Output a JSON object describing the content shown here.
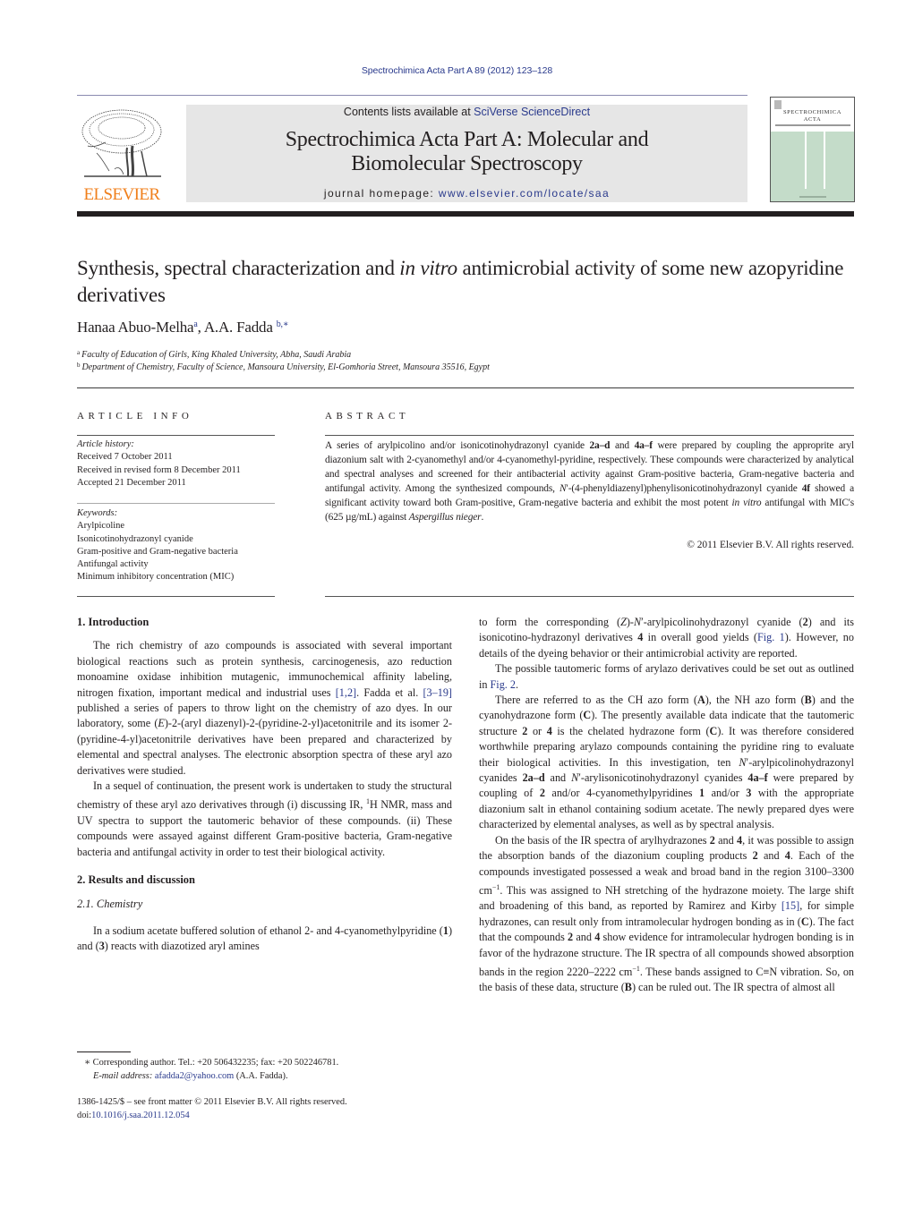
{
  "header": {
    "running_head": "Spectrochimica Acta Part A 89 (2012) 123–128",
    "contents_prefix": "Contents lists available at ",
    "contents_link": "SciVerse ScienceDirect",
    "journal_title_line1": "Spectrochimica Acta Part A: Molecular and",
    "journal_title_line2": "Biomolecular Spectroscopy",
    "homepage_prefix": "journal homepage: ",
    "homepage_link": "www.elsevier.com/locate/saa",
    "publisher_logo_text": "ELSEVIER",
    "cover_title_line1": "SPECTROCHIMICA",
    "cover_title_line2": "ACTA",
    "colors": {
      "link": "#2a3a8c",
      "elsevier_orange": "#f07f1b",
      "box_gray": "#e6e6e6",
      "cover_green": "#c4dcc9"
    }
  },
  "article": {
    "title_part1": "Synthesis, spectral characterization and ",
    "title_italic": "in vitro",
    "title_part2": " antimicrobial activity of some new azopyridine derivatives",
    "authors": [
      {
        "name": "Hanaa Abuo-Melha",
        "sup": "a"
      },
      {
        "name": "A.A. Fadda",
        "sup": "b,∗"
      }
    ],
    "author_separator": ", ",
    "affiliations": [
      {
        "mark": "a",
        "text": "Faculty of Education of Girls, King Khaled University, Abha, Saudi Arabia"
      },
      {
        "mark": "b",
        "text": "Department of Chemistry, Faculty of Science, Mansoura University, El-Gomhoria Street, Mansoura 35516, Egypt"
      }
    ]
  },
  "article_info": {
    "label": "ARTICLE INFO",
    "history_head": "Article history:",
    "history": [
      "Received 7 October 2011",
      "Received in revised form 8 December 2011",
      "Accepted 21 December 2011"
    ],
    "keywords_head": "Keywords:",
    "keywords": [
      "Arylpicoline",
      "Isonicotinohydrazonyl cyanide",
      "Gram-positive and Gram-negative bacteria",
      "Antifungal activity",
      "Minimum inhibitory concentration (MIC)"
    ]
  },
  "abstract": {
    "label": "ABSTRACT",
    "t1": "A series of arylpicolino and/or isonicotinohydrazonyl cyanide ",
    "b1": "2a–d",
    "t2": " and ",
    "b2": "4a–f",
    "t3": " were prepared by coupling the approprite aryl diazonium salt with 2-cyanomethyl and/or 4-cyanomethyl-pyridine, respectively. These compounds were characterized by analytical and spectral analyses and screened for their antibacterial activity against Gram-positive bacteria, Gram-negative bacteria and antifungal activity. Among the synthesized compounds, ",
    "i1": "N",
    "t4": "′-(4-phenyldiazenyl)phenylisonicotinohydrazonyl cyanide ",
    "b3": "4f",
    "t5": " showed a significant activity toward both Gram-positive, Gram-negative bacteria and exhibit the most potent ",
    "i2": "in vitro",
    "t6": " antifungal with MIC's (625 µg/mL) against ",
    "i3": "Aspergillus nieger",
    "t7": ".",
    "copyright": "© 2011 Elsevier B.V. All rights reserved."
  },
  "body": {
    "sec1_heading": "1.  Introduction",
    "intro_p1": {
      "a": "The rich chemistry of azo compounds is associated with several important biological reactions such as protein synthesis, carcinogenesis, azo reduction monoamine oxidase inhibition mutagenic, immunochemical affinity labeling, nitrogen fixation, important medical and industrial uses ",
      "ref1": "[1,2]",
      "b": ". Fadda et al. ",
      "ref2": "[3–19]",
      "c": " published a series of papers to throw light on the chemistry of azo dyes. In our laboratory, some (",
      "e": "E",
      "d": ")-2-(aryl diazenyl)-2-(pyridine-2-yl)acetonitrile and its isomer 2-(pyridine-4-yl)acetonitrile derivatives have been prepared and characterized by elemental and spectral analyses. The electronic absorption spectra of these aryl azo derivatives were studied."
    },
    "intro_p2": {
      "a": "In a sequel of continuation, the present work is undertaken to study the structural chemistry of these aryl azo derivatives through (i) discussing IR, ",
      "sup": "1",
      "b": "H NMR, mass and UV spectra to support the tautomeric behavior of these compounds. (ii) These compounds were assayed against different Gram-positive bacteria, Gram-negative bacteria and antifungal activity in order to test their biological activity."
    },
    "sec2_heading": "2.  Results and discussion",
    "sec21_heading": "2.1.  Chemistry",
    "chem_p1": {
      "a": "In a sodium acetate buffered solution of ethanol 2- and 4-cyanomethylpyridine (",
      "b1": "1",
      "b": ") and (",
      "b2": "3",
      "c": ") reacts with diazotized aryl amines to form the corresponding (",
      "z": "Z",
      "d": ")-",
      "n": "N",
      "e": "′-arylpicolinohydrazonyl cyanide (",
      "b3": "2",
      "f": ") and its isonicotino-hydrazonyl derivatives ",
      "b4": "4",
      "g": " in overall good yields (",
      "ref": "Fig. 1",
      "h": "). However, no details of the dyeing behavior or their antimicrobial activity are reported."
    },
    "right_p2": {
      "a": "The possible tautomeric forms of arylazo derivatives could be set out as outlined in ",
      "ref": "Fig. 2",
      "b": "."
    },
    "right_p3": {
      "a": "There are referred to as the CH azo form (",
      "bA": "A",
      "b": "), the NH azo form (",
      "bB": "B",
      "c": ") and the cyanohydrazone form (",
      "bC": "C",
      "d": "). The presently available data indicate that the tautomeric structure ",
      "b2": "2",
      "e": " or ",
      "b4": "4",
      "f": " is the chelated hydrazone form (",
      "bC2": "C",
      "g": "). It was therefore considered worthwhile preparing arylazo compounds containing the pyridine ring to evaluate their biological activities. In this investigation, ten ",
      "n1": "N",
      "h": "′-arylpicolinohydrazonyl cyanides ",
      "bx1": "2a–d",
      "i": " and ",
      "n2": "N",
      "j": "′-arylisonicotinohydrazonyl cyanides ",
      "bx2": "4a–f",
      "k": " were prepared by coupling of ",
      "bx3": "2",
      "l": " and/or 4-cyanomethylpyridines ",
      "bx4": "1",
      "m": " and/or ",
      "bx5": "3",
      "n": " with the appropriate diazonium salt in ethanol containing sodium acetate. The newly prepared dyes were characterized by elemental analyses, as well as by spectral analysis."
    },
    "right_p4": {
      "a": "On the basis of the IR spectra of arylhydrazones ",
      "b1": "2",
      "b": " and ",
      "b2": "4",
      "c": ", it was possible to assign the absorption bands of the diazonium coupling products ",
      "b3": "2",
      "d": " and ",
      "b4": "4",
      "e": ". Each of the compounds investigated possessed a weak and broad band in the region 3100–3300 cm",
      "sup1": "−1",
      "f": ". This was assigned to NH stretching of the hydrazone moiety. The large shift and broadening of this band, as reported by Ramirez and Kirby ",
      "ref": "[15]",
      "g": ", for simple hydrazones, can result only from intramolecular hydrogen bonding as in (",
      "bC": "C",
      "h": "). The fact that the compounds ",
      "b5": "2",
      "i": " and ",
      "b6": "4",
      "j": " show evidence for intramolecular hydrogen bonding is in favor of the hydrazone structure. The IR spectra of all compounds showed absorption bands in the region 2220–2222 cm",
      "sup2": "−1",
      "k": ". These bands assigned to C≡N vibration. So, on the basis of these data, structure (",
      "bB": "B",
      "l": ") can be ruled out. The IR spectra of almost all"
    }
  },
  "footnotes": {
    "star": "∗",
    "corresponding": " Corresponding author. Tel.: +20 506432235; fax: +20 502246781.",
    "email_label": "E-mail address:",
    "email": "afadda2@yahoo.com",
    "email_suffix": " (A.A. Fadda).",
    "issn_line": "1386-1425/$ – see front matter © 2011 Elsevier B.V. All rights reserved.",
    "doi_prefix": "doi:",
    "doi": "10.1016/j.saa.2011.12.054"
  }
}
